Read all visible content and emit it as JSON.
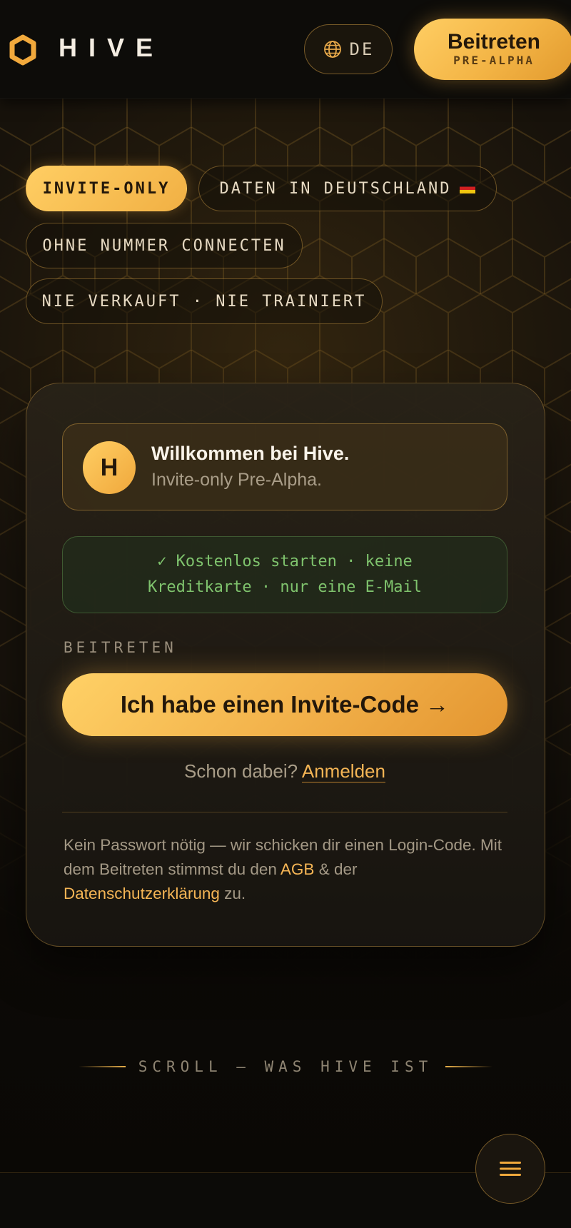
{
  "header": {
    "logo_text": "HIVE",
    "language": "DE",
    "join_label": "Beitreten",
    "join_sublabel": "PRE-ALPHA"
  },
  "chips": [
    {
      "label": "INVITE-ONLY",
      "active": true
    },
    {
      "label": "DATEN IN DEUTSCHLAND",
      "flag": "de-flag-icon",
      "active": false
    },
    {
      "label": "OHNE NUMMER CONNECTEN",
      "active": false
    },
    {
      "label": "NIE VERKAUFT · NIE TRAINIERT",
      "active": false
    }
  ],
  "card": {
    "avatar_letter": "H",
    "welcome_title": "Willkommen bei Hive.",
    "welcome_subtitle": "Invite-only Pre-Alpha.",
    "free_line1": "✓ Kostenlos starten · keine",
    "free_line2": "Kreditkarte · nur eine E-Mail",
    "section_label": "BEITRETEN",
    "cta_label": "Ich habe einen Invite-Code →",
    "login_prompt": "Schon dabei?",
    "login_link": "Anmelden",
    "legal_part1": "Kein Passwort nötig — wir schicken dir einen Login-Code. Mit dem Beitreten stimmst du den ",
    "legal_agb": "AGB",
    "legal_part2": " & der ",
    "legal_privacy": "Datenschutzerklärung",
    "legal_part3": " zu."
  },
  "scroll_hint": "SCROLL — WAS HIVE IST",
  "colors": {
    "accent": "#f5b555",
    "accent_gradient_start": "#ffce63",
    "accent_gradient_end": "#e29a2e",
    "background": "#0d0b07",
    "success": "#7fc36d"
  },
  "icons": [
    "hexagon-logo-icon",
    "globe-icon",
    "menu-icon",
    "de-flag-icon"
  ]
}
